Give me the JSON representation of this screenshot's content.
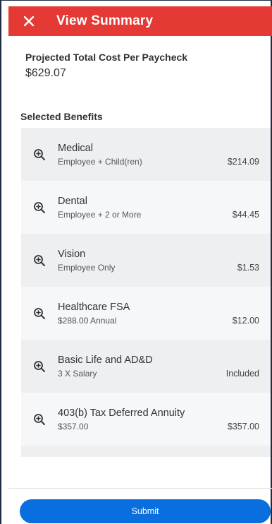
{
  "header": {
    "title": "View Summary",
    "close_icon": "close-icon",
    "background_color": "#e53935"
  },
  "summary": {
    "projected_label": "Projected Total Cost Per Paycheck",
    "projected_value": "$629.07"
  },
  "benefits_section": {
    "heading": "Selected Benefits",
    "items": [
      {
        "name": "Medical",
        "detail": "Employee + Child(ren)",
        "cost": "$214.09",
        "icon": "zoom-in-icon"
      },
      {
        "name": "Dental",
        "detail": "Employee + 2 or More",
        "cost": "$44.45",
        "icon": "zoom-in-icon"
      },
      {
        "name": "Vision",
        "detail": "Employee Only",
        "cost": "$1.53",
        "icon": "zoom-in-icon"
      },
      {
        "name": "Healthcare FSA",
        "detail": "$288.00 Annual",
        "cost": "$12.00",
        "icon": "zoom-in-icon"
      },
      {
        "name": "Basic Life and AD&D",
        "detail": "3 X Salary",
        "cost": "Included",
        "icon": "zoom-in-icon"
      },
      {
        "name": "403(b) Tax Deferred Annuity",
        "detail": "$357.00",
        "cost": "$357.00",
        "icon": "zoom-in-icon"
      }
    ]
  },
  "footer": {
    "submit_label": "Submit",
    "submit_color": "#0a6fde"
  }
}
